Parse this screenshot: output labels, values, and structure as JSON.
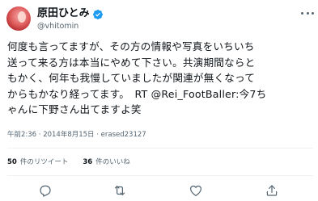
{
  "user": {
    "display_name": "原田ひとみ",
    "handle": "@vhitomin"
  },
  "tweet": {
    "text": "何度も言ってますが、その方の情報や写真をいちいち\n送って来る方は本当にやめて下さい。共演期間ならと\nもかく、何年も我慢していましたが関連が無くなって\nからもかなり経ってます。　RT @Rei_FootBaller:今7ち\nゃんに下野さん出てますよ笑",
    "meta": "午前2:36 · 2014年8月15日 · erased23127"
  },
  "stats": {
    "retweets_count": "50",
    "retweets_label": "件のリツイート",
    "likes_count": "36",
    "likes_label": "件のいいね"
  },
  "colors": {
    "verified": "#1d9bf0",
    "text": "#0f1419",
    "muted": "#536471"
  },
  "icons": [
    "reply-icon",
    "retweet-icon",
    "like-icon",
    "share-icon",
    "more-icon",
    "verified-badge-icon"
  ]
}
